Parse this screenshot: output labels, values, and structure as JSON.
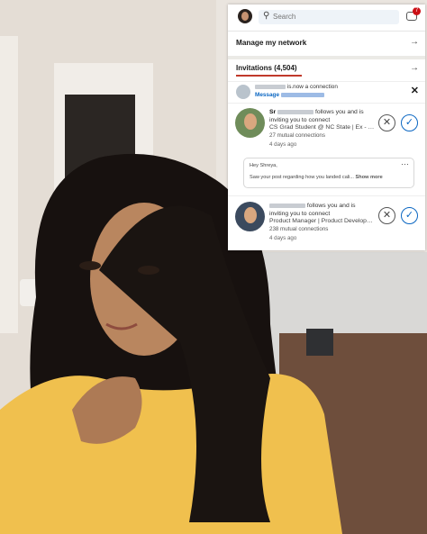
{
  "colors": {
    "accent": "#0a66c2",
    "badge": "#cc1016",
    "invitations_underline": "#c0392b"
  },
  "header": {
    "search_placeholder": "Search",
    "message_badge": "7",
    "search_icon": "search-icon",
    "messaging_icon": "messaging-icon"
  },
  "manage_network": {
    "label": "Manage my network",
    "icon": "arrow-right-icon"
  },
  "invitations": {
    "label": "Invitations (4,504)",
    "icon": "arrow-right-icon"
  },
  "notice": {
    "text": "is.now a connection",
    "message_label": "Message",
    "dismiss_icon": "close-icon"
  },
  "cards": [
    {
      "name": "Sr",
      "follow_text": "follows you and is inviting you to connect",
      "headline": "CS Grad Student @ NC State | Ex - Sr. ...",
      "mutual": "27 mutual connections",
      "time": "4 days ago"
    },
    {
      "name": "",
      "follow_text": "follows you and is inviting you to connect",
      "headline": "Product Manager | Product Developm...",
      "mutual": "238 mutual connections",
      "time": "4 days ago"
    }
  ],
  "note": {
    "greeting": "Hey Shreya,",
    "body": "Saw your post regarding how you landed cali...",
    "more": "Show more",
    "menu_icon": "more-icon"
  }
}
